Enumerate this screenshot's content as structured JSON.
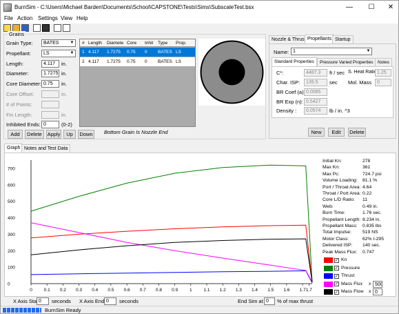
{
  "window": {
    "title": "BurnSim - C:\\Users\\Michael Barden\\Documents\\School\\CAPSTONE\\Tests\\Sims\\SubscaleTest.bsx"
  },
  "menu": [
    "File",
    "Action",
    "Settings",
    "View",
    "Help"
  ],
  "grains": {
    "group_label": "Grains",
    "grain_type_label": "Grain Type:",
    "grain_type": "BATES",
    "propellant_label": "Propellant:",
    "propellant": "LS",
    "length_label": "Length:",
    "length": "4.117",
    "length_unit": "in.",
    "diameter_label": "Diameter:",
    "diameter": "1.7275",
    "diameter_unit": "in.",
    "core_diameter_label": "Core Diameter:",
    "core_diameter": "0.75",
    "core_diameter_unit": "in.",
    "core_offset_label": "Core Offset:",
    "core_offset_unit": "in.",
    "points_label": "# of Points:",
    "fin_length_label": "Fin Length:",
    "fin_length_unit": "in.",
    "inhibited_label": "Inhibited Ends:",
    "inhibited": "0",
    "inhibited_range": "(0-2)",
    "buttons": {
      "add": "Add",
      "delete": "Delete",
      "apply": "Apply",
      "up": "Up",
      "down": "Down"
    },
    "table_headers": [
      "#",
      "Length",
      "Diamete",
      "Core",
      "Inhit",
      "Type",
      "Prop."
    ],
    "rows": [
      [
        "1",
        "4.117",
        "1.7275",
        "0.75",
        "0",
        "BATES",
        "LS"
      ],
      [
        "2",
        "4.117",
        "1.7275",
        "0.75",
        "0",
        "BATES",
        "LS"
      ]
    ],
    "nozzle_note": "Bottom Grain Is Nozzle End"
  },
  "prop_panel": {
    "tabs": [
      "Nozzle & Thrust",
      "Propellants",
      "Startup"
    ],
    "name_label": "Name:",
    "name": "1",
    "subtabs": [
      "Standard Properties",
      "Pressure Varied Properties",
      "Notes"
    ],
    "cstar_label": "C*:",
    "cstar": "4487.3",
    "cstar_unit": "ft / sec",
    "heat_ratio_label": "S. Heat Ratio:",
    "heat_ratio": "1.25",
    "isp_label": "Char. ISP:",
    "isp": "139.5",
    "isp_unit": "sec",
    "mol_mass_label": "Mol. Mass",
    "mol_mass": "0",
    "br_coef_label": "BR Coef (a):",
    "br_coef": "0.0085",
    "br_exp_label": "BR Exp (n):",
    "br_exp": "0.5427",
    "density_label": "Density :",
    "density": "0.0574",
    "density_unit": "lb /  in. ^3",
    "buttons": {
      "new": "New",
      "edit": "Edit",
      "delete": "Delete"
    }
  },
  "graph_tabs": [
    "Graph",
    "Notes and Test Data"
  ],
  "stats": [
    [
      "Initial Kn:",
      "278"
    ],
    [
      "Max Kn:",
      "361"
    ],
    [
      "Max Pc:",
      "724.7 psi"
    ],
    [
      "Volume Loading:",
      "81.1 %"
    ],
    [
      "Port / Throat Area:",
      "4.64"
    ],
    [
      "Throat / Port Area:",
      "0.22"
    ],
    [
      "Core L/D Ratio:",
      "11"
    ],
    [
      "Web:",
      "0.49 in."
    ],
    [
      "Burn Time:",
      "1.76 sec."
    ],
    [
      "Propellant Length:",
      "8.234 in."
    ],
    [
      "Propellant Mass:",
      "0.835 lbs"
    ],
    [
      "Total Impulse:",
      "519 NS"
    ],
    [
      "Motor Class:",
      "62% I-295"
    ],
    [
      "Delivered ISP:",
      "140 sec."
    ],
    [
      "Peak Mass Flux:",
      "0.747"
    ]
  ],
  "legend": [
    {
      "label": "Kn",
      "color": "#ff0000"
    },
    {
      "label": "Pressure",
      "color": "#008000"
    },
    {
      "label": "Thrust",
      "color": "#0000ff"
    },
    {
      "label": "Mass Flux",
      "color": "#ff00ff",
      "scale": "500"
    },
    {
      "label": "Mass Flow",
      "color": "#000000",
      "scale": "0"
    }
  ],
  "scale_prefix": "x",
  "chart_data": {
    "type": "line",
    "x_ticks": [
      "0",
      "0.1",
      "0.2",
      "0.3",
      "0.4",
      "0.5",
      "0.6",
      "0.7",
      "0.8",
      "0.9",
      "1",
      "1.1",
      "1.2",
      "1.3",
      "1.4",
      "1.5",
      "1.6",
      "1.7",
      "1.7"
    ],
    "y_ticks": [
      "0",
      "100",
      "200",
      "300",
      "400",
      "500",
      "600",
      "700"
    ],
    "xlim": [
      0,
      1.76
    ],
    "ylim": [
      0,
      750
    ],
    "series": [
      {
        "name": "Kn",
        "color": "#ff0000",
        "x": [
          0,
          0.3,
          0.6,
          0.9,
          1.2,
          1.5,
          1.72,
          1.76
        ],
        "y": [
          278,
          300,
          318,
          333,
          345,
          352,
          355,
          10
        ]
      },
      {
        "name": "Pressure",
        "color": "#008000",
        "x": [
          0,
          0.3,
          0.6,
          0.9,
          1.2,
          1.5,
          1.72,
          1.76
        ],
        "y": [
          440,
          530,
          610,
          670,
          705,
          720,
          715,
          10
        ]
      },
      {
        "name": "Thrust",
        "color": "#0000ff",
        "x": [
          0,
          0.3,
          0.6,
          0.9,
          1.2,
          1.5,
          1.72,
          1.76
        ],
        "y": [
          55,
          60,
          64,
          68,
          72,
          75,
          78,
          5
        ]
      },
      {
        "name": "Mass Flux",
        "color": "#ff00ff",
        "x": [
          0,
          0.3,
          0.6,
          0.9,
          1.2,
          1.5,
          1.72,
          1.76
        ],
        "y": [
          370,
          310,
          250,
          200,
          155,
          112,
          80,
          10
        ]
      },
      {
        "name": "Mass Flow",
        "color": "#000000",
        "x": [
          0,
          0.3,
          0.6,
          0.9,
          1.2,
          1.5,
          1.72,
          1.76
        ],
        "y": [
          175,
          205,
          230,
          250,
          262,
          270,
          272,
          8
        ]
      }
    ]
  },
  "bottom": {
    "x_start_label": "X Axis Start",
    "x_start": "0",
    "x_start_unit": "seconds",
    "x_end_label": "X Axis End",
    "x_end": "0",
    "x_end_unit": "seconds",
    "end_sim_label": "End Sim at",
    "end_sim": "0",
    "end_sim_unit": "% of max thrust"
  },
  "status": {
    "text": "BurnSim Ready"
  }
}
